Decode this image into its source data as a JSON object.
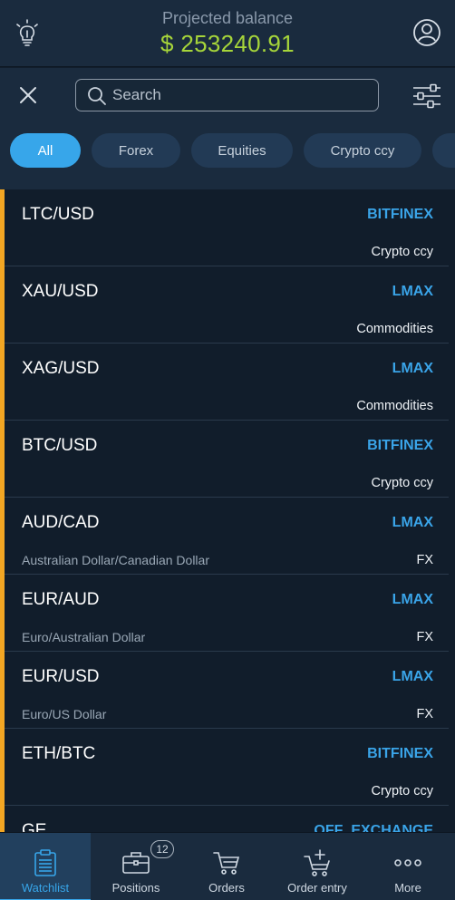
{
  "header": {
    "title": "Projected balance",
    "balance": "$ 253240.91",
    "tips_icon": "lightbulb-icon",
    "profile_icon": "user-profile-icon"
  },
  "search": {
    "placeholder": "Search",
    "value": "",
    "close_icon": "close-icon",
    "filter_icon": "sliders-icon"
  },
  "filters": [
    {
      "label": "All",
      "active": true
    },
    {
      "label": "Forex",
      "active": false
    },
    {
      "label": "Equities",
      "active": false
    },
    {
      "label": "Crypto ccy",
      "active": false
    }
  ],
  "instruments": [
    {
      "symbol": "LTC/USD",
      "exchange": "BITFINEX",
      "description": "",
      "asset_class": "Crypto ccy"
    },
    {
      "symbol": "XAU/USD",
      "exchange": "LMAX",
      "description": "",
      "asset_class": "Commodities"
    },
    {
      "symbol": "XAG/USD",
      "exchange": "LMAX",
      "description": "",
      "asset_class": "Commodities"
    },
    {
      "symbol": "BTC/USD",
      "exchange": "BITFINEX",
      "description": "",
      "asset_class": "Crypto ccy"
    },
    {
      "symbol": "AUD/CAD",
      "exchange": "LMAX",
      "description": "Australian Dollar/Canadian Dollar",
      "asset_class": "FX"
    },
    {
      "symbol": "EUR/AUD",
      "exchange": "LMAX",
      "description": "Euro/Australian Dollar",
      "asset_class": "FX"
    },
    {
      "symbol": "EUR/USD",
      "exchange": "LMAX",
      "description": "Euro/US Dollar",
      "asset_class": "FX"
    },
    {
      "symbol": "ETH/BTC",
      "exchange": "BITFINEX",
      "description": "",
      "asset_class": "Crypto ccy"
    },
    {
      "symbol": "GE",
      "exchange": "OFF_EXCHANGE",
      "description": "",
      "asset_class": ""
    }
  ],
  "tabs": [
    {
      "label": "Watchlist",
      "icon": "clipboard-icon",
      "active": true
    },
    {
      "label": "Positions",
      "icon": "briefcase-icon",
      "active": false,
      "badge": "12"
    },
    {
      "label": "Orders",
      "icon": "cart-icon",
      "active": false
    },
    {
      "label": "Order entry",
      "icon": "cart-add-icon",
      "active": false
    },
    {
      "label": "More",
      "icon": "more-dots-icon",
      "active": false
    }
  ],
  "colors": {
    "accent": "#37a6ea",
    "balance": "#a6d53a",
    "selection_bar": "#f3a623",
    "background": "#111d2b",
    "header": "#1a2b3e"
  }
}
